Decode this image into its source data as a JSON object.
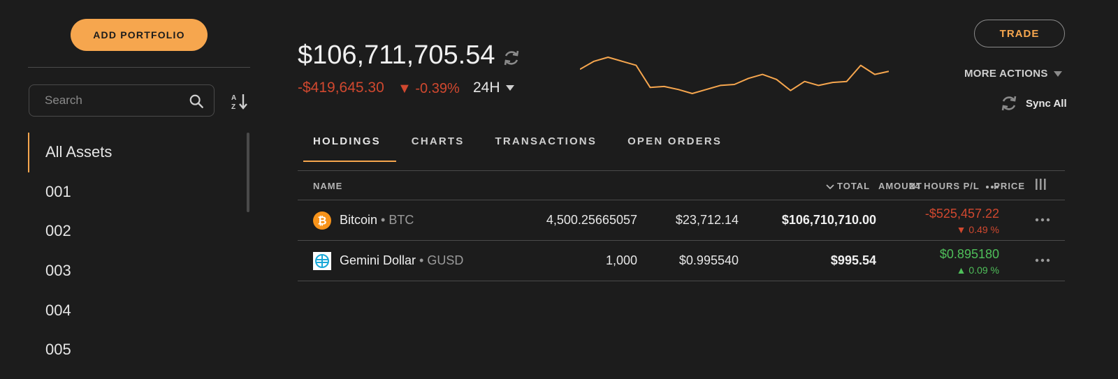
{
  "sidebar": {
    "add_portfolio_label": "ADD PORTFOLIO",
    "search_placeholder": "Search",
    "items": [
      {
        "label": "All Assets"
      },
      {
        "label": "001"
      },
      {
        "label": "002"
      },
      {
        "label": "003"
      },
      {
        "label": "004"
      },
      {
        "label": "005"
      }
    ],
    "active_item": "All Assets"
  },
  "header": {
    "total_value": "$106,711,705.54",
    "change_abs": "-$419,645.30",
    "change_pct": "▼ -0.39%",
    "period": "24H",
    "trade_label": "TRADE",
    "more_actions_label": "MORE ACTIONS",
    "sync_label": "Sync All"
  },
  "sparkline_values": [
    62,
    70,
    74,
    70,
    66,
    44,
    45,
    42,
    38,
    42,
    46,
    47,
    53,
    57,
    52,
    41,
    50,
    46,
    49,
    50,
    66,
    57,
    60
  ],
  "tabs": [
    {
      "label": "HOLDINGS",
      "active": true
    },
    {
      "label": "CHARTS",
      "active": false
    },
    {
      "label": "TRANSACTIONS",
      "active": false
    },
    {
      "label": "OPEN ORDERS",
      "active": false
    }
  ],
  "table": {
    "headers": {
      "name": "NAME",
      "amount": "AMOUNT",
      "price": "PRICE",
      "total": "TOTAL",
      "pl": "24 HOURS P/L"
    },
    "rows": [
      {
        "name": "Bitcoin",
        "symbol": " • BTC",
        "amount": "4,500.25665057",
        "price": "$23,712.14",
        "total": "$106,710,710.00",
        "pl_value": "-$525,457.22",
        "pl_pct": "▼ 0.49 %",
        "icon": "bitcoin-icon"
      },
      {
        "name": "Gemini Dollar",
        "symbol": " • GUSD",
        "amount": "1,000",
        "price": "$0.995540",
        "total": "$995.54",
        "pl_value": "$0.895180",
        "pl_pct": "▲ 0.09 %",
        "icon": "gemini-dollar-icon"
      }
    ]
  },
  "colors": {
    "accent": "#f6a64e",
    "negative": "#d0482f",
    "positive": "#4fbf5a",
    "background": "#1c1c1c"
  }
}
